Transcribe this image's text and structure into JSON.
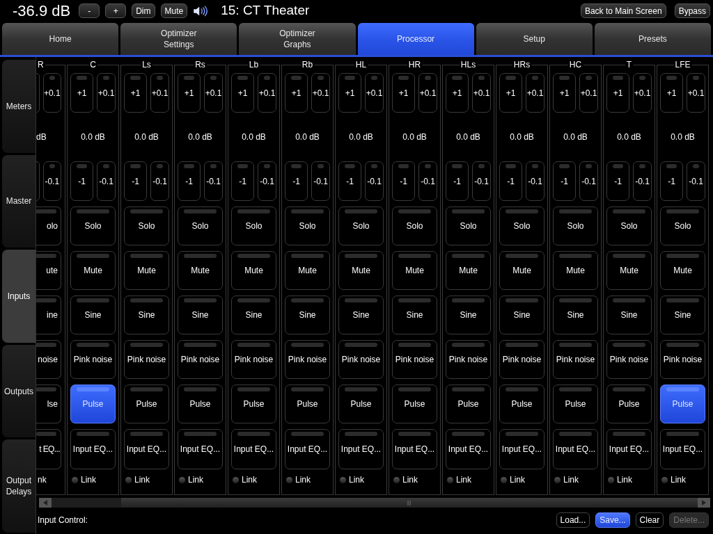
{
  "top_bar": {
    "volume": "-36.9 dB",
    "buttons": [
      "-",
      "+",
      "Dim",
      "Mute"
    ],
    "preset_name": "15: CT Theater",
    "right_buttons": [
      "Back to Main Screen",
      "Bypass"
    ]
  },
  "tabs": [
    {
      "label": "Home",
      "selected": false
    },
    {
      "label": "Optimizer\nSettings",
      "selected": false
    },
    {
      "label": "Optimizer\nGraphs",
      "selected": false
    },
    {
      "label": "Processor",
      "selected": true
    },
    {
      "label": "Setup",
      "selected": false
    },
    {
      "label": "Presets",
      "selected": false
    }
  ],
  "side_tabs": [
    {
      "label": "Meters",
      "selected": false
    },
    {
      "label": "Master",
      "selected": false
    },
    {
      "label": "Inputs",
      "selected": true
    },
    {
      "label": "Outputs",
      "selected": false
    },
    {
      "label": "Output\nDelays",
      "selected": false
    }
  ],
  "channels": [
    {
      "kind": "clipped",
      "name": "R",
      "up": [
        "+0.1"
      ],
      "gain": "dB",
      "down": [
        "-0.1"
      ],
      "buttons": [
        {
          "label": "olo",
          "selected": false
        },
        {
          "label": "ute",
          "selected": false
        },
        {
          "label": "ine",
          "selected": false
        },
        {
          "label": "noise",
          "selected": false
        },
        {
          "label": "lse",
          "selected": false
        }
      ],
      "eq": "t EQ...",
      "link": "nk"
    },
    {
      "kind": "full",
      "name": "C",
      "up": [
        "+1",
        "+0.1"
      ],
      "gain": "0.0 dB",
      "down": [
        "-1",
        "-0.1"
      ],
      "buttons": [
        {
          "label": "Solo",
          "selected": false
        },
        {
          "label": "Mute",
          "selected": false
        },
        {
          "label": "Sine",
          "selected": false
        },
        {
          "label": "Pink noise",
          "selected": false
        },
        {
          "label": "Pulse",
          "selected": true
        }
      ],
      "eq": "Input EQ...",
      "link": "Link"
    },
    {
      "kind": "full",
      "name": "Ls",
      "up": [
        "+1",
        "+0.1"
      ],
      "gain": "0.0 dB",
      "down": [
        "-1",
        "-0.1"
      ],
      "buttons": [
        {
          "label": "Solo",
          "selected": false
        },
        {
          "label": "Mute",
          "selected": false
        },
        {
          "label": "Sine",
          "selected": false
        },
        {
          "label": "Pink noise",
          "selected": false
        },
        {
          "label": "Pulse",
          "selected": false
        }
      ],
      "eq": "Input EQ...",
      "link": "Link"
    },
    {
      "kind": "full",
      "name": "Rs",
      "up": [
        "+1",
        "+0.1"
      ],
      "gain": "0.0 dB",
      "down": [
        "-1",
        "-0.1"
      ],
      "buttons": [
        {
          "label": "Solo",
          "selected": false
        },
        {
          "label": "Mute",
          "selected": false
        },
        {
          "label": "Sine",
          "selected": false
        },
        {
          "label": "Pink noise",
          "selected": false
        },
        {
          "label": "Pulse",
          "selected": false
        }
      ],
      "eq": "Input EQ...",
      "link": "Link"
    },
    {
      "kind": "full",
      "name": "Lb",
      "up": [
        "+1",
        "+0.1"
      ],
      "gain": "0.0 dB",
      "down": [
        "-1",
        "-0.1"
      ],
      "buttons": [
        {
          "label": "Solo",
          "selected": false
        },
        {
          "label": "Mute",
          "selected": false
        },
        {
          "label": "Sine",
          "selected": false
        },
        {
          "label": "Pink noise",
          "selected": false
        },
        {
          "label": "Pulse",
          "selected": false
        }
      ],
      "eq": "Input EQ...",
      "link": "Link"
    },
    {
      "kind": "full",
      "name": "Rb",
      "up": [
        "+1",
        "+0.1"
      ],
      "gain": "0.0 dB",
      "down": [
        "-1",
        "-0.1"
      ],
      "buttons": [
        {
          "label": "Solo",
          "selected": false
        },
        {
          "label": "Mute",
          "selected": false
        },
        {
          "label": "Sine",
          "selected": false
        },
        {
          "label": "Pink noise",
          "selected": false
        },
        {
          "label": "Pulse",
          "selected": false
        }
      ],
      "eq": "Input EQ...",
      "link": "Link"
    },
    {
      "kind": "full",
      "name": "HL",
      "up": [
        "+1",
        "+0.1"
      ],
      "gain": "0.0 dB",
      "down": [
        "-1",
        "-0.1"
      ],
      "buttons": [
        {
          "label": "Solo",
          "selected": false
        },
        {
          "label": "Mute",
          "selected": false
        },
        {
          "label": "Sine",
          "selected": false
        },
        {
          "label": "Pink noise",
          "selected": false
        },
        {
          "label": "Pulse",
          "selected": false
        }
      ],
      "eq": "Input EQ...",
      "link": "Link"
    },
    {
      "kind": "full",
      "name": "HR",
      "up": [
        "+1",
        "+0.1"
      ],
      "gain": "0.0 dB",
      "down": [
        "-1",
        "-0.1"
      ],
      "buttons": [
        {
          "label": "Solo",
          "selected": false
        },
        {
          "label": "Mute",
          "selected": false
        },
        {
          "label": "Sine",
          "selected": false
        },
        {
          "label": "Pink noise",
          "selected": false
        },
        {
          "label": "Pulse",
          "selected": false
        }
      ],
      "eq": "Input EQ...",
      "link": "Link"
    },
    {
      "kind": "full",
      "name": "HLs",
      "up": [
        "+1",
        "+0.1"
      ],
      "gain": "0.0 dB",
      "down": [
        "-1",
        "-0.1"
      ],
      "buttons": [
        {
          "label": "Solo",
          "selected": false
        },
        {
          "label": "Mute",
          "selected": false
        },
        {
          "label": "Sine",
          "selected": false
        },
        {
          "label": "Pink noise",
          "selected": false
        },
        {
          "label": "Pulse",
          "selected": false
        }
      ],
      "eq": "Input EQ...",
      "link": "Link"
    },
    {
      "kind": "full",
      "name": "HRs",
      "up": [
        "+1",
        "+0.1"
      ],
      "gain": "0.0 dB",
      "down": [
        "-1",
        "-0.1"
      ],
      "buttons": [
        {
          "label": "Solo",
          "selected": false
        },
        {
          "label": "Mute",
          "selected": false
        },
        {
          "label": "Sine",
          "selected": false
        },
        {
          "label": "Pink noise",
          "selected": false
        },
        {
          "label": "Pulse",
          "selected": false
        }
      ],
      "eq": "Input EQ...",
      "link": "Link"
    },
    {
      "kind": "full",
      "name": "HC",
      "up": [
        "+1",
        "+0.1"
      ],
      "gain": "0.0 dB",
      "down": [
        "-1",
        "-0.1"
      ],
      "buttons": [
        {
          "label": "Solo",
          "selected": false
        },
        {
          "label": "Mute",
          "selected": false
        },
        {
          "label": "Sine",
          "selected": false
        },
        {
          "label": "Pink noise",
          "selected": false
        },
        {
          "label": "Pulse",
          "selected": false
        }
      ],
      "eq": "Input EQ...",
      "link": "Link"
    },
    {
      "kind": "full",
      "name": "T",
      "up": [
        "+1",
        "+0.1"
      ],
      "gain": "0.0 dB",
      "down": [
        "-1",
        "-0.1"
      ],
      "buttons": [
        {
          "label": "Solo",
          "selected": false
        },
        {
          "label": "Mute",
          "selected": false
        },
        {
          "label": "Sine",
          "selected": false
        },
        {
          "label": "Pink noise",
          "selected": false
        },
        {
          "label": "Pulse",
          "selected": false
        }
      ],
      "eq": "Input EQ...",
      "link": "Link"
    },
    {
      "kind": "full",
      "name": "LFE",
      "up": [
        "+1",
        "+0.1"
      ],
      "gain": "0.0 dB",
      "down": [
        "-1",
        "-0.1"
      ],
      "buttons": [
        {
          "label": "Solo",
          "selected": false
        },
        {
          "label": "Mute",
          "selected": false
        },
        {
          "label": "Sine",
          "selected": false
        },
        {
          "label": "Pink noise",
          "selected": false
        },
        {
          "label": "Pulse",
          "selected": true
        }
      ],
      "eq": "Input EQ...",
      "link": "Link"
    }
  ],
  "footer": {
    "label": "Input Control:",
    "buttons": [
      {
        "label": "Load...",
        "selected": false,
        "disabled": false
      },
      {
        "label": "Save...",
        "selected": true,
        "disabled": false
      },
      {
        "label": "Clear",
        "selected": false,
        "disabled": false
      },
      {
        "label": "Delete...",
        "selected": false,
        "disabled": true
      }
    ]
  }
}
